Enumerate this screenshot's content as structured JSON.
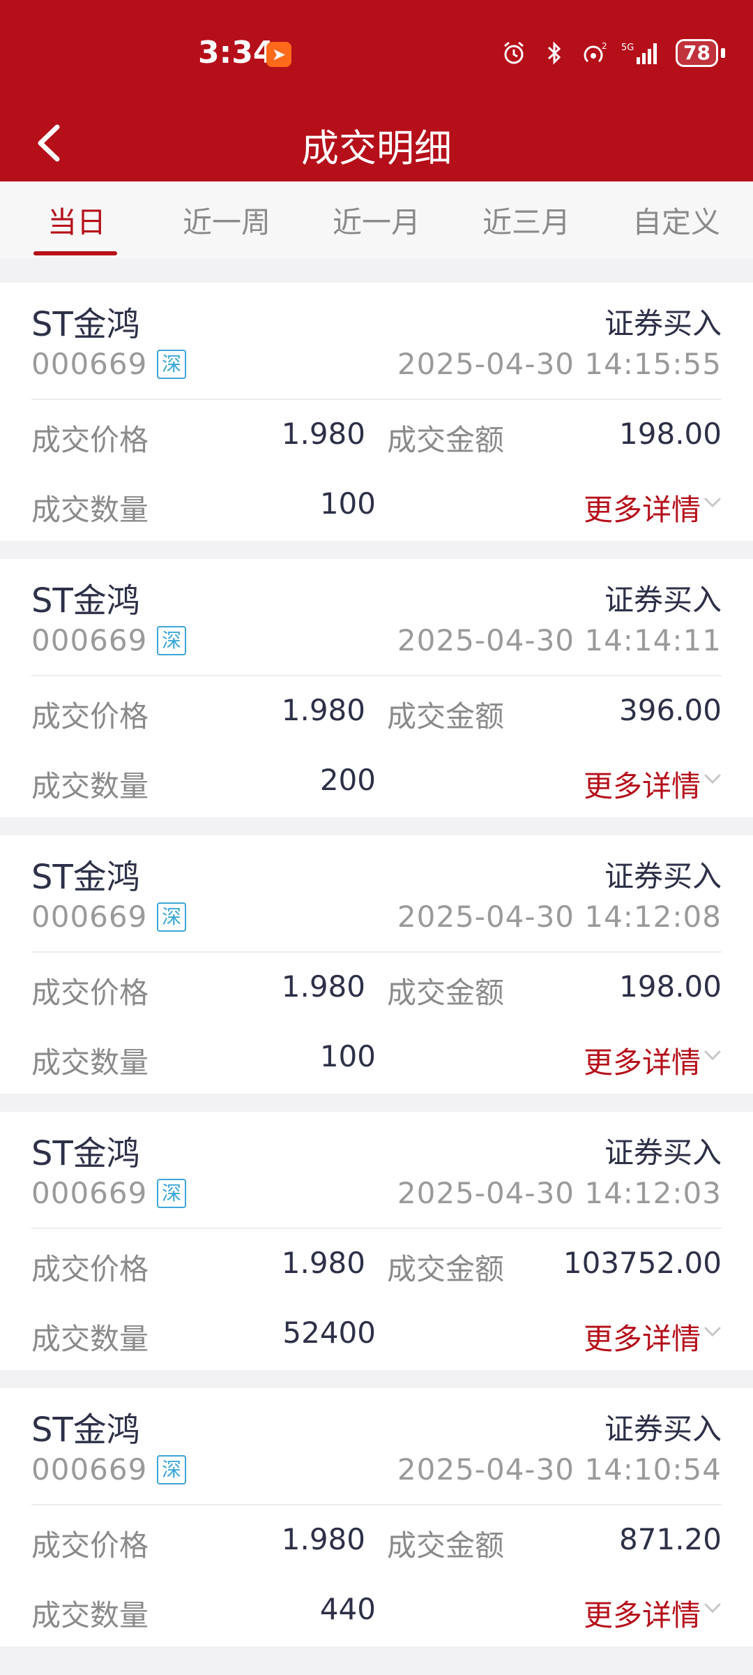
{
  "status_bar": {
    "time": "3:34",
    "battery": "78",
    "network": "5G",
    "icons": [
      "app-notification-icon",
      "alarm-icon",
      "bluetooth-icon",
      "hotspot-icon",
      "signal-icon",
      "battery-icon"
    ]
  },
  "header": {
    "title": "成交明细",
    "back_icon": "chevron-left-icon"
  },
  "tabs": [
    {
      "label": "当日",
      "active": true
    },
    {
      "label": "近一周",
      "active": false
    },
    {
      "label": "近一月",
      "active": false
    },
    {
      "label": "近三月",
      "active": false
    },
    {
      "label": "自定义",
      "active": false
    }
  ],
  "labels": {
    "price": "成交价格",
    "amount": "成交金额",
    "quantity": "成交数量",
    "more": "更多详情"
  },
  "trades": [
    {
      "name": "ST金鸿",
      "code": "000669",
      "market": "深",
      "type": "证券买入",
      "time": "2025-04-30 14:15:55",
      "price": "1.980",
      "amount": "198.00",
      "quantity": "100"
    },
    {
      "name": "ST金鸿",
      "code": "000669",
      "market": "深",
      "type": "证券买入",
      "time": "2025-04-30 14:14:11",
      "price": "1.980",
      "amount": "396.00",
      "quantity": "200"
    },
    {
      "name": "ST金鸿",
      "code": "000669",
      "market": "深",
      "type": "证券买入",
      "time": "2025-04-30 14:12:08",
      "price": "1.980",
      "amount": "198.00",
      "quantity": "100"
    },
    {
      "name": "ST金鸿",
      "code": "000669",
      "market": "深",
      "type": "证券买入",
      "time": "2025-04-30 14:12:03",
      "price": "1.980",
      "amount": "103752.00",
      "quantity": "52400"
    },
    {
      "name": "ST金鸿",
      "code": "000669",
      "market": "深",
      "type": "证券买入",
      "time": "2025-04-30 14:10:54",
      "price": "1.980",
      "amount": "871.20",
      "quantity": "440"
    }
  ],
  "colors": {
    "brand_red": "#b50f1a",
    "text_dark": "#2d3047",
    "text_gray": "#8a8a8a",
    "market_blue": "#3ba6d8"
  }
}
